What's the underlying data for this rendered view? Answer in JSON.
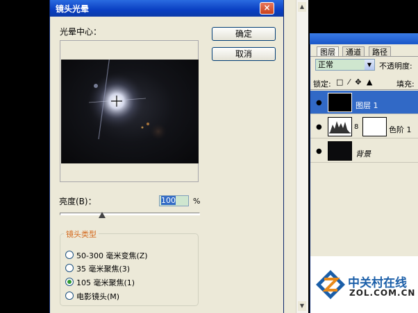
{
  "dialog": {
    "title": "镜头光晕",
    "close_glyph": "×",
    "center_label": "光晕中心：",
    "ok_label": "确定",
    "cancel_label": "取消",
    "brightness_label": "亮度(B)：",
    "brightness_value": "100",
    "brightness_unit": "%",
    "brightness_level": 100,
    "lens_group_title": "镜头类型",
    "lens_options": [
      {
        "label": "50-300 毫米变焦(Z)",
        "selected": false
      },
      {
        "label": "35 毫米聚焦(3)",
        "selected": false
      },
      {
        "label": "105 毫米聚焦(1)",
        "selected": true
      },
      {
        "label": "电影镜头(M)",
        "selected": false
      }
    ]
  },
  "scroll": {
    "up": "▲",
    "down": "▼"
  },
  "layers_panel": {
    "tabs": [
      "图层",
      "通道",
      "路径"
    ],
    "active_tab": 0,
    "blend_mode": "正常",
    "blend_arrow": "▼",
    "opacity_label": "不透明度:",
    "lock_label": "锁定:",
    "lock_icons": "□ ⁄ ✥ ▲",
    "fill_label": "填充:",
    "eye_glyph": "●",
    "link_glyph": "8",
    "layers": [
      {
        "name": "图层 1",
        "selected": true
      },
      {
        "name": "色阶 1",
        "selected": false
      },
      {
        "name": "背景",
        "selected": false
      }
    ]
  },
  "watermark": {
    "brand": "中关村在线",
    "url": "ZOL.COM.CN"
  },
  "colors": {
    "title_bar": "#0a3fc2",
    "dialog_bg": "#ece9d8",
    "selection": "#316ac5",
    "legend_text": "#d46a1e",
    "logo_blue": "#1a5ea8",
    "logo_orange": "#e88a1a"
  }
}
